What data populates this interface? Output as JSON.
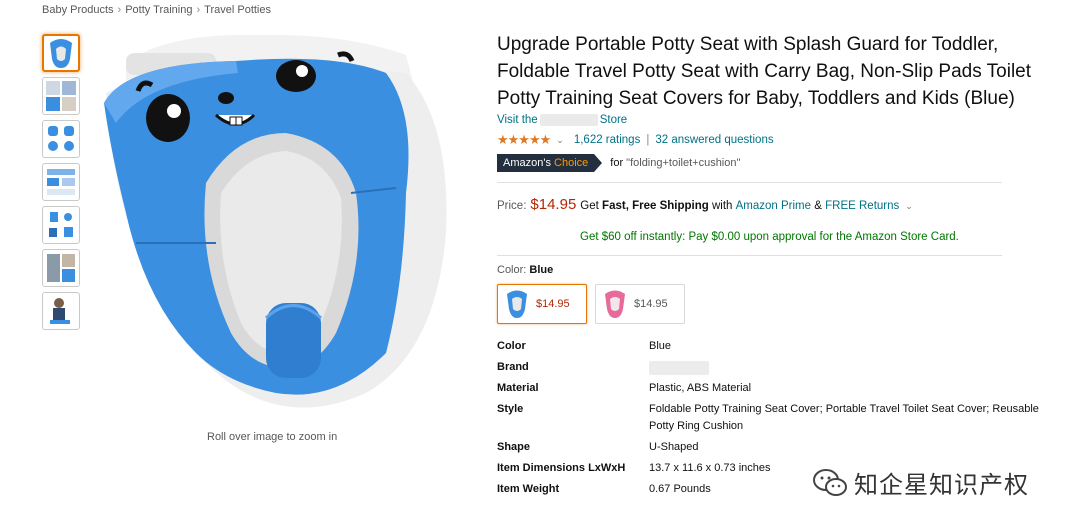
{
  "breadcrumb": [
    "Baby Products",
    "Potty Training",
    "Travel Potties"
  ],
  "gallery": {
    "thumbnails": [
      "seat-front",
      "seat-in-use",
      "seat-folding-steps",
      "seat-size-chart",
      "seat-features",
      "seat-lifestyle",
      "child-on-potty"
    ],
    "zoom_hint": "Roll over image to zoom in"
  },
  "product": {
    "title": "Upgrade Portable Potty Seat with Splash Guard for Toddler, Foldable Travel Potty Seat with Carry Bag, Non-Slip Pads Toilet Potty Training Seat Covers for Baby, Toddlers and Kids (Blue)",
    "store_prefix": "Visit the",
    "store_suffix": "Store",
    "stars": "★★★★★",
    "rating_count": "1,622 ratings",
    "answered": "32 answered questions",
    "choice_label": "Amazon's",
    "choice_word": "Choice",
    "choice_for": "for",
    "choice_query": "\"folding+toilet+cushion\""
  },
  "pricing": {
    "label": "Price:",
    "value": "$14.95",
    "get": "Get",
    "shipping": "Fast, Free Shipping",
    "with": "with",
    "prime": "Amazon Prime",
    "amp": "&",
    "returns": "FREE Returns",
    "card_offer": "Get $60 off instantly: Pay $0.00 upon approval for the Amazon Store Card."
  },
  "color": {
    "label": "Color:",
    "selected": "Blue",
    "options": [
      {
        "name": "Blue",
        "price": "$14.95",
        "color": "#3b8fe0"
      },
      {
        "name": "Pink",
        "price": "$14.95",
        "color": "#e86a9a"
      }
    ]
  },
  "specs": [
    {
      "key": "Color",
      "value": "Blue"
    },
    {
      "key": "Brand",
      "value": ""
    },
    {
      "key": "Material",
      "value": "Plastic, ABS Material"
    },
    {
      "key": "Style",
      "value": "Foldable Potty Training Seat Cover; Portable Travel Toilet Seat Cover; Reusable Potty Ring Cushion"
    },
    {
      "key": "Shape",
      "value": "U-Shaped"
    },
    {
      "key": "Item Dimensions LxWxH",
      "value": "13.7 x 11.6 x 0.73 inches"
    },
    {
      "key": "Item Weight",
      "value": "0.67 Pounds"
    }
  ],
  "watermark": "知企星知识产权",
  "colors": {
    "accent": "#e77600",
    "price": "#b12704",
    "link": "#007185",
    "seat_blue": "#3b8fe0",
    "offer_green": "#007600"
  }
}
